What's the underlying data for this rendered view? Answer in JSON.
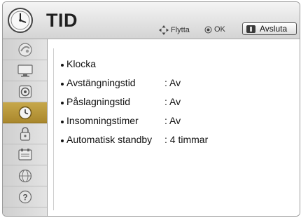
{
  "header": {
    "title": "TID",
    "move_hint": "Flytta",
    "ok_hint": "OK",
    "exit_label": "Avsluta"
  },
  "sidebar": {
    "items": [
      {
        "icon": "picture-icon",
        "active": false
      },
      {
        "icon": "screen-icon",
        "active": false
      },
      {
        "icon": "audio-icon",
        "active": false
      },
      {
        "icon": "clock-icon",
        "active": true
      },
      {
        "icon": "lock-icon",
        "active": false
      },
      {
        "icon": "options-icon",
        "active": false
      },
      {
        "icon": "network-icon",
        "active": false
      },
      {
        "icon": "help-icon",
        "active": false
      }
    ]
  },
  "menu": {
    "items": [
      {
        "label": "Klocka",
        "value": ""
      },
      {
        "label": "Avstängningstid",
        "value": ": Av"
      },
      {
        "label": "Påslagningstid",
        "value": ": Av"
      },
      {
        "label": "Insomningstimer",
        "value": ": Av"
      },
      {
        "label": "Automatisk standby",
        "value": ": 4 timmar"
      }
    ]
  },
  "colors": {
    "active_tab": "#b8973a",
    "header_bg": "#e4e4e4",
    "sidebar_bg": "#d8d8d8"
  }
}
